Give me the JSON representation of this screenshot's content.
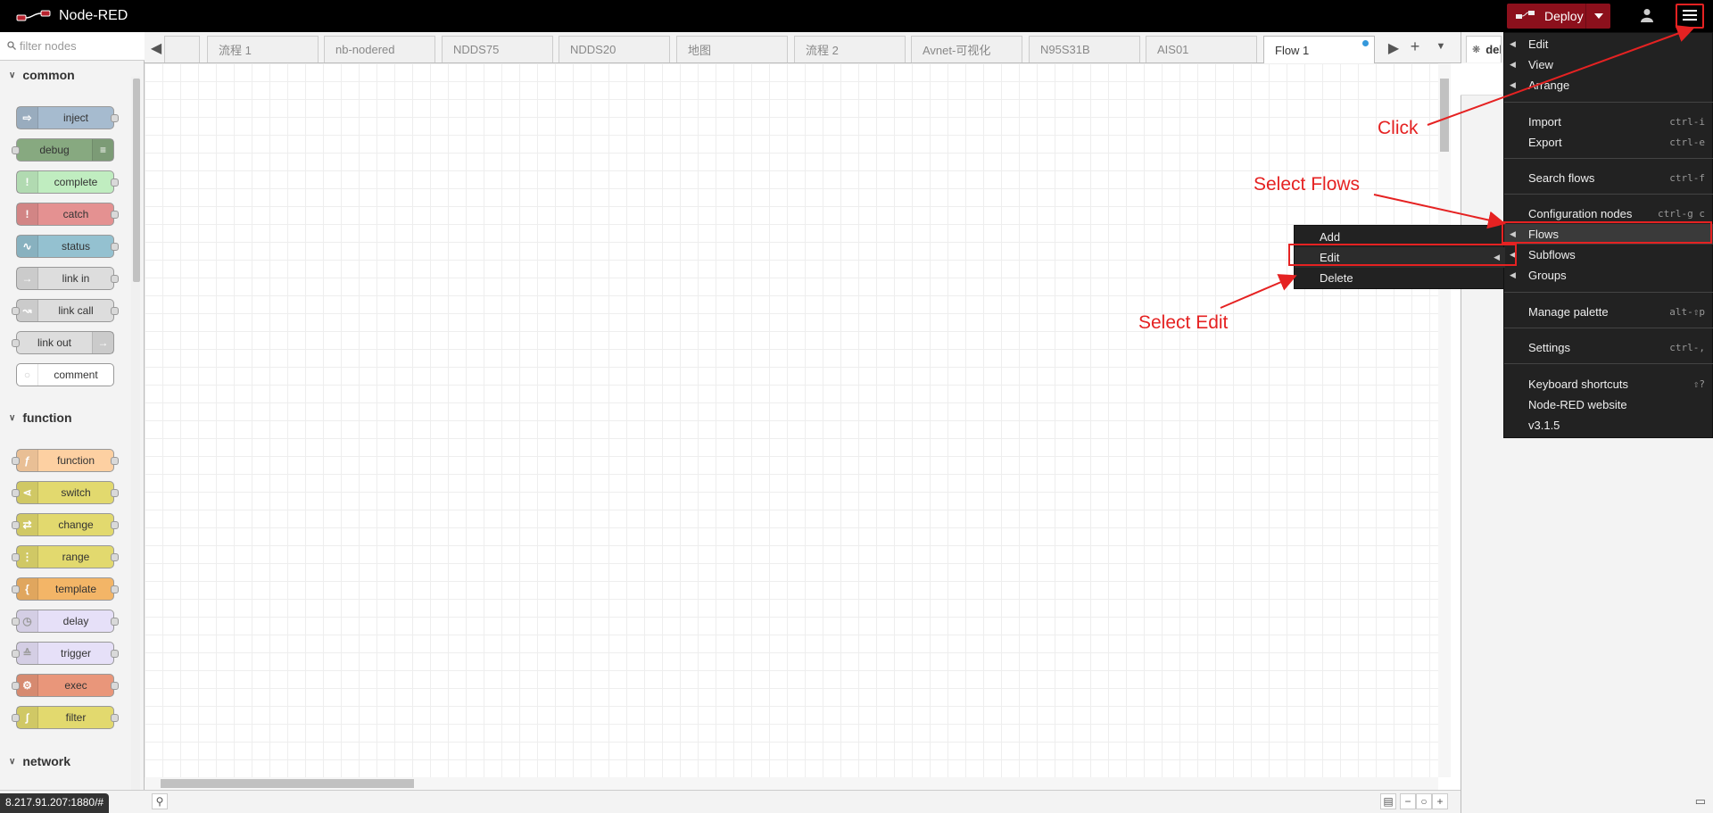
{
  "header": {
    "app_title": "Node-RED",
    "deploy_label": "Deploy"
  },
  "palette": {
    "filter_placeholder": "filter nodes",
    "categories": [
      {
        "name": "common",
        "nodes": [
          "inject",
          "debug",
          "complete",
          "catch",
          "status",
          "link in",
          "link call",
          "link out",
          "comment"
        ]
      },
      {
        "name": "function",
        "nodes": [
          "function",
          "switch",
          "change",
          "range",
          "template",
          "delay",
          "trigger",
          "exec",
          "filter"
        ]
      },
      {
        "name": "network",
        "nodes": []
      }
    ]
  },
  "tabs": [
    "",
    "流程 1",
    "nb-nodered",
    "NDDS75",
    "NDDS20",
    "地图",
    "流程 2",
    "Avnet-可视化",
    "N95S31B",
    "AIS01",
    "Flow 1"
  ],
  "active_tab": "Flow 1",
  "sidebar": {
    "tab_label": "debug"
  },
  "main_menu": {
    "items": [
      {
        "label": "Edit",
        "submenu": true
      },
      {
        "label": "View",
        "submenu": true
      },
      {
        "label": "Arrange",
        "submenu": true
      },
      {
        "label": "Import",
        "shortcut": "ctrl-i"
      },
      {
        "label": "Export",
        "shortcut": "ctrl-e"
      },
      {
        "label": "Search flows",
        "shortcut": "ctrl-f"
      },
      {
        "label": "Configuration nodes",
        "shortcut": "ctrl-g c"
      },
      {
        "label": "Flows",
        "submenu": true,
        "highlighted": true
      },
      {
        "label": "Subflows",
        "submenu": true
      },
      {
        "label": "Groups",
        "submenu": true
      },
      {
        "label": "Manage palette",
        "shortcut": "alt-⇧p"
      },
      {
        "label": "Settings",
        "shortcut": "ctrl-,"
      },
      {
        "label": "Keyboard shortcuts",
        "shortcut": "⇧?"
      },
      {
        "label": "Node-RED website"
      },
      {
        "label": "v3.1.5"
      }
    ]
  },
  "flows_submenu": {
    "items": [
      "Add",
      "Edit",
      "Delete"
    ],
    "highlighted": "Edit"
  },
  "annotations": {
    "click": "Click",
    "select_flows": "Select Flows",
    "select_edit": "Select Edit"
  },
  "status_url": "8.217.91.207:1880/#",
  "colors": {
    "header_bg": "#000000",
    "deploy_bg": "#8c101c",
    "annotation_red": "#e52222",
    "menu_bg": "#222222",
    "inject": "#a6bbcf",
    "debug": "#87a980",
    "complete": "#c0edc0",
    "catch": "#e49191",
    "status": "#94c1d0",
    "link": "#dddddd",
    "comment": "#ffffff",
    "function": "#fdd0a2",
    "switch": "#e2d96e",
    "change": "#e2d96e",
    "range": "#e2d96e",
    "template": "#f3b567",
    "delay": "#e6e0f8",
    "trigger": "#e6e0f8",
    "exec": "#e9967a",
    "filter": "#e2d96e"
  }
}
